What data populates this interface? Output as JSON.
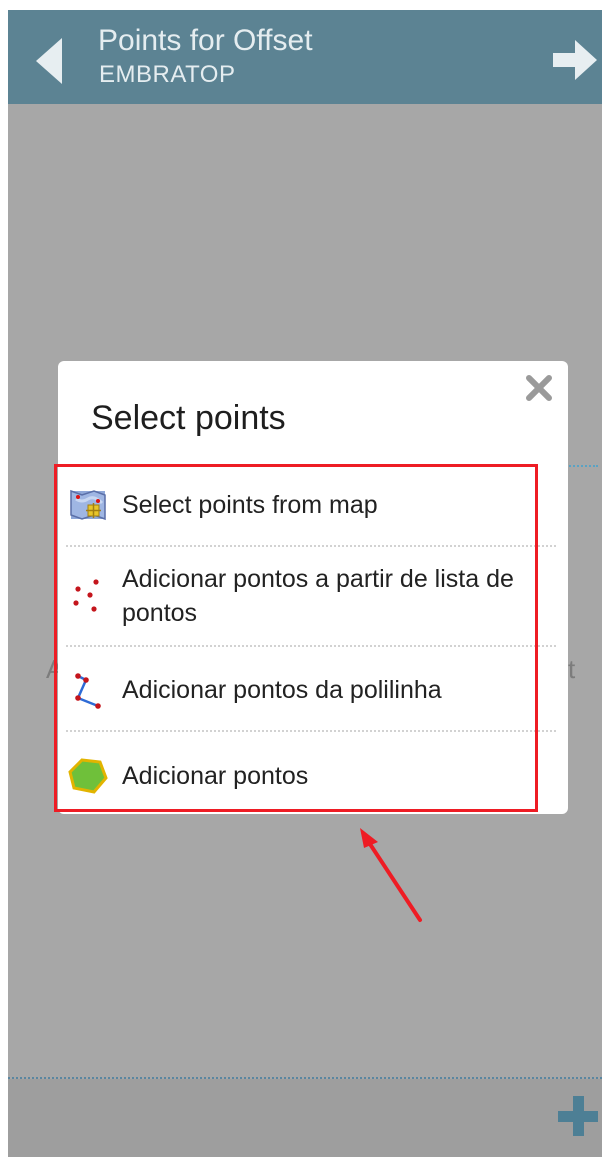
{
  "header": {
    "title": "Points for Offset",
    "subtitle": "EMBRATOP"
  },
  "background": {
    "left_fragment": "A",
    "right_fragment": "t"
  },
  "dialog": {
    "title": "Select points",
    "options": [
      {
        "label": "Select points from map",
        "icon": "map-icon"
      },
      {
        "label": "Adicionar pontos a partir de lista de pontos",
        "icon": "point-list-icon"
      },
      {
        "label": "Adicionar pontos da polilinha",
        "icon": "polyline-icon"
      },
      {
        "label": "Adicionar pontos",
        "icon": "polygon-icon"
      }
    ]
  },
  "colors": {
    "header_bg": "#5c8393",
    "overlay_bg": "#a7a7a7",
    "highlight_border": "#ee1c24",
    "accent": "#4d7f95"
  }
}
